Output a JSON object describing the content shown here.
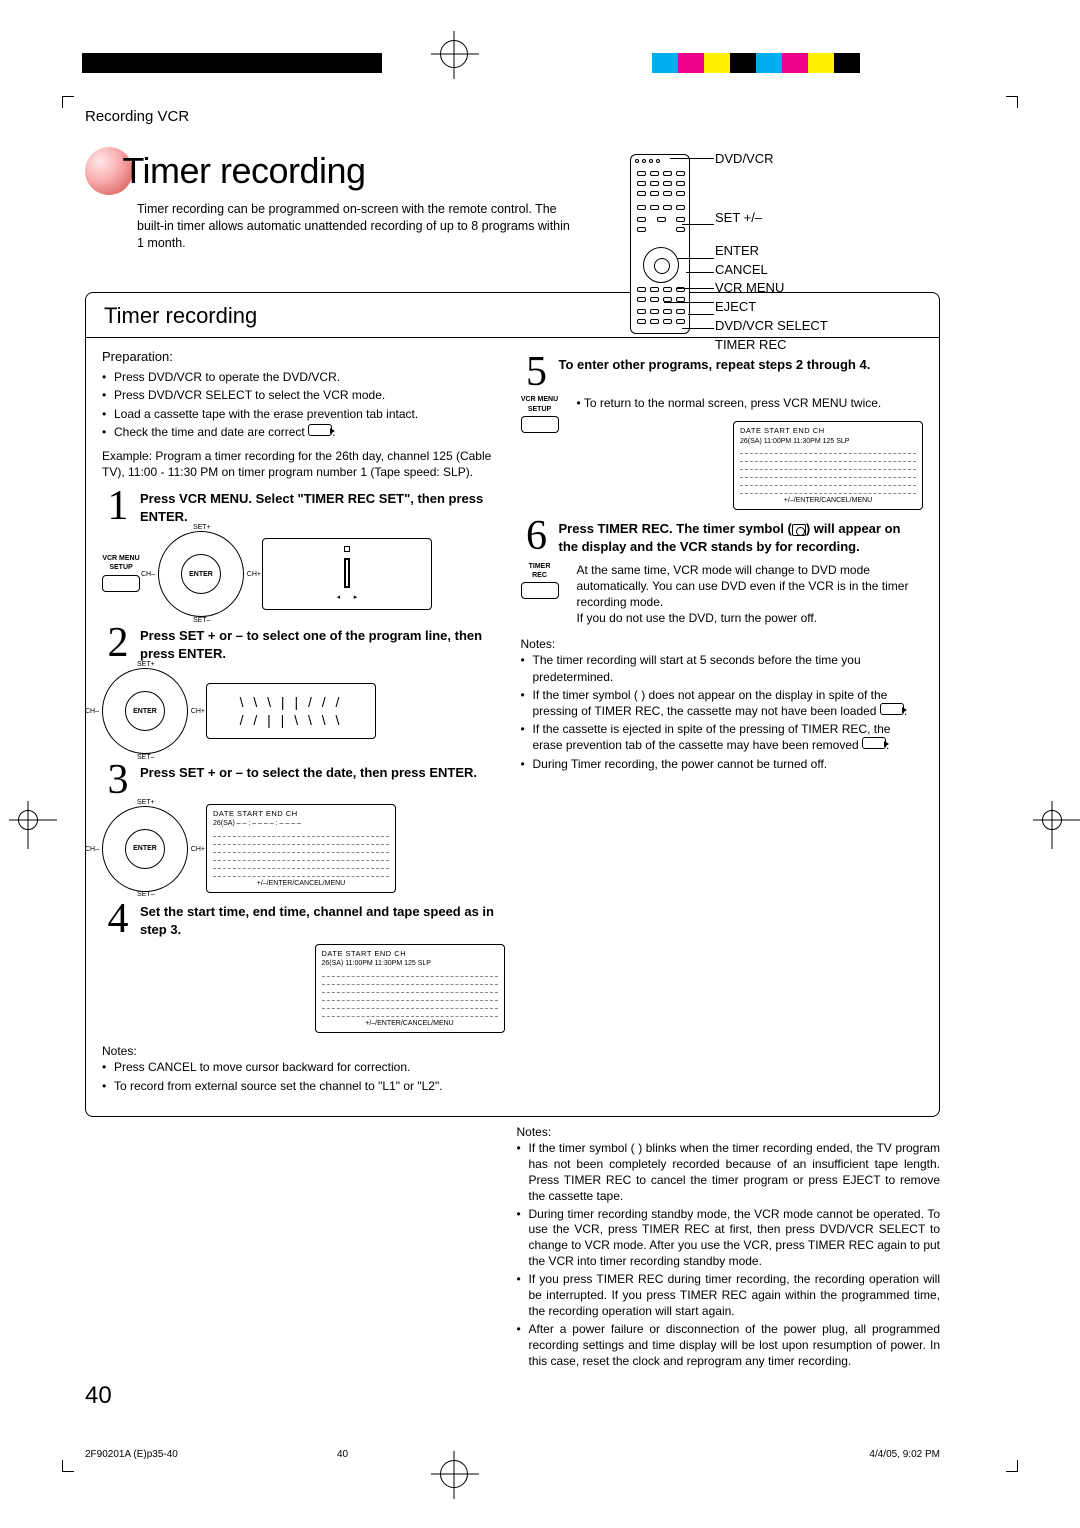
{
  "breadcrumb": "Recording VCR",
  "page_title": "Timer recording",
  "intro": "Timer recording can be programmed on-screen with the remote control. The built-in timer allows automatic unattended recording of up to 8 programs within 1 month.",
  "remote_labels": {
    "a": "DVD/VCR",
    "b": "SET +/–",
    "c": "ENTER",
    "d": "CANCEL",
    "e": "VCR MENU",
    "f": "EJECT",
    "g": "DVD/VCR SELECT",
    "h": "TIMER REC"
  },
  "section_heading": "Timer recording",
  "prep_heading": "Preparation:",
  "prep_bullets": [
    "Press DVD/VCR to operate the DVD/VCR.",
    "Press DVD/VCR SELECT to select the VCR mode.",
    "Load a cassette tape with the erase prevention tab intact.",
    "Check the time and date are correct"
  ],
  "example": "Example: Program a timer recording for the 26th day, channel 125 (Cable TV), 11:00 - 11:30 PM on timer program number 1 (Tape speed: SLP).",
  "steps": {
    "s1": "Press VCR MENU. Select \"TIMER REC SET\", then press ENTER.",
    "s2": "Press SET + or – to select one of the program line, then press ENTER.",
    "s3": "Press SET + or – to select the date, then press ENTER.",
    "s4": "Set the start time, end time, channel and tape speed as in step 3.",
    "s5a": "To enter other programs, repeat steps 2 through 4.",
    "s5b": "To return to the normal screen, press VCR MENU twice.",
    "s6a": "Press TIMER REC. The timer symbol (",
    "s6b": ") will appear on the display and the VCR stands by for recording.",
    "s6c": "At the same time, VCR mode will change to DVD mode automatically. You can use DVD even if the VCR is in the timer recording mode.\nIf you do not use the DVD, turn the power off."
  },
  "vcr_menu_label": "VCR MENU\nSETUP",
  "timer_rec_label": "TIMER REC",
  "dpad_enter": "ENTER",
  "dpad_set_plus": "SET+",
  "dpad_set_minus": "SET–",
  "dpad_ch_plus": "CH+",
  "dpad_ch_minus": "CH–",
  "osd_header": "DATE    START   END   CH",
  "osd_foot": "+/–/ENTER/CANCEL/MENU",
  "osd_row_step3": "26(SA)   – – : – –   – – : – –   – –",
  "osd_row_step4": "26(SA)   11:00PM 11:30PM 125 SLP",
  "osd_row_step5": "26(SA)   11:00PM 11:30PM 125 SLP",
  "notes4_title": "Notes:",
  "notes4": [
    "Press CANCEL to move cursor backward for correction.",
    "To record from external source set the channel to \"L1\" or \"L2\"."
  ],
  "notes6_title": "Notes:",
  "notes6": [
    "The timer recording will start at 5 seconds before the time you predetermined.",
    "If the timer symbol (      ) does not appear on the display in spite of the pressing of TIMER REC, the cassette may not have been loaded",
    "If the cassette is ejected in spite of the pressing of TIMER REC, the erase prevention tab of the cassette may have been removed",
    "During Timer recording, the power cannot be turned off."
  ],
  "notes_outside_title": "Notes:",
  "notes_outside": [
    "If the timer symbol (      ) blinks when the timer recording ended, the TV program has not been completely recorded because of an insufficient tape length. Press TIMER REC to cancel the timer program or press EJECT to remove the cassette tape.",
    "During timer recording standby mode, the VCR mode cannot be operated. To use the VCR, press TIMER REC at first, then press DVD/VCR SELECT to change to VCR mode. After you use the VCR, press TIMER REC again to put the VCR into timer recording standby mode.",
    "If you press TIMER REC during timer recording, the recording operation will be interrupted. If you press TIMER REC again within the programmed time, the recording operation will start again.",
    "After a power failure or disconnection of the power plug, all programmed recording settings and time display will be lost upon resumption of power. In this case, reset the clock          and reprogram any timer recording."
  ],
  "page_number": "40",
  "footer_file": "2F90201A (E)p35-40",
  "footer_page": "40",
  "footer_time": "4/4/05, 9:02 PM",
  "colorbar_colors": [
    "#00aeef",
    "#ec008c",
    "#fff200",
    "#000000",
    "#00aeef",
    "#ec008c",
    "#fff200",
    "#000000"
  ]
}
